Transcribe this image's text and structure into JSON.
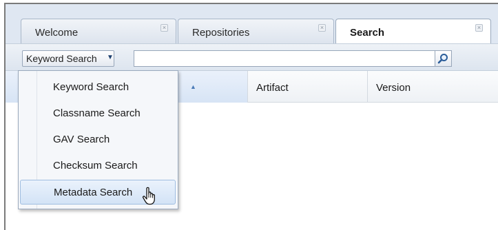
{
  "tabs": [
    {
      "label": "Welcome",
      "close": "×"
    },
    {
      "label": "Repositories",
      "close": "×"
    },
    {
      "label": "Search",
      "close": "×",
      "active": true
    }
  ],
  "toolbar": {
    "search_type_label": "Keyword Search",
    "caret": "▼",
    "search_value": "",
    "search_icon": "magnifier-icon"
  },
  "grid": {
    "columns": [
      {
        "label": "",
        "sorted": true,
        "sort_indicator": "▲"
      },
      {
        "label": "Artifact"
      },
      {
        "label": "Version"
      }
    ]
  },
  "dropdown": {
    "items": [
      {
        "label": "Keyword Search"
      },
      {
        "label": "Classname Search"
      },
      {
        "label": "GAV Search"
      },
      {
        "label": "Checksum Search"
      },
      {
        "label": "Metadata Search",
        "highlighted": true
      }
    ]
  },
  "colors": {
    "tabstrip_bg": "#dfe7f2",
    "highlight_bg": "#d3e3f6",
    "accent": "#1d3f6e"
  },
  "cursor_icon": "hand-pointer-icon"
}
